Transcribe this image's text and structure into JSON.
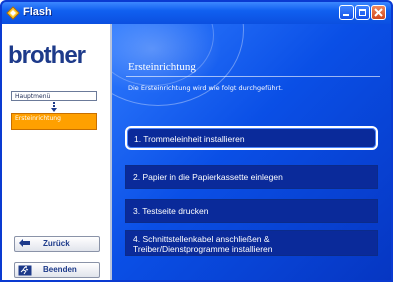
{
  "window": {
    "title": "Flash"
  },
  "sidebar": {
    "logo": "brother",
    "nav_main": "Hauptmenü",
    "nav_current": "Ersteinrichtung",
    "back_label": "Zurück",
    "quit_label": "Beenden"
  },
  "main": {
    "heading": "Ersteinrichtung",
    "intro": "Die Ersteinrichtung wird wie folgt durchgeführt.",
    "steps": [
      {
        "label": "1. Trommeleinheit installieren",
        "selected": true
      },
      {
        "label": "2. Papier in die Papierkassette einlegen",
        "selected": false
      },
      {
        "label": "3. Testseite drucken",
        "selected": false
      },
      {
        "line1": "4. Schnittstellenkabel anschließen &",
        "line2": "Treiber/Dienstprogramme installieren",
        "selected": false
      }
    ]
  },
  "colors": {
    "accent": "#ffa000",
    "panel_blue": "#0a4fe6",
    "brand": "#1d3a8a"
  }
}
